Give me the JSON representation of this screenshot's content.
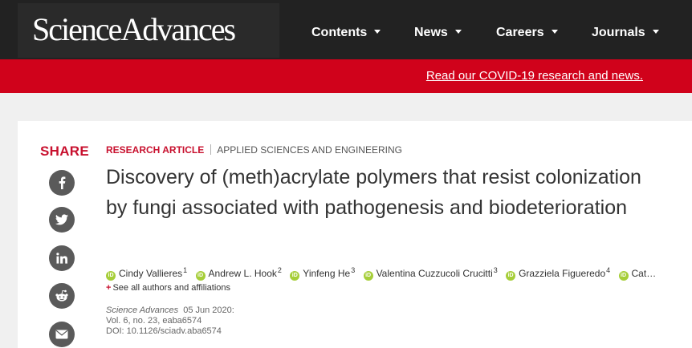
{
  "header": {
    "logo_text": "ScienceAdvances",
    "nav": [
      {
        "label": "Contents"
      },
      {
        "label": "News"
      },
      {
        "label": "Careers"
      },
      {
        "label": "Journals"
      }
    ]
  },
  "banner": {
    "link_text": "Read our COVID-19 research and news."
  },
  "share": {
    "label": "SHARE",
    "icons": [
      "facebook-icon",
      "twitter-icon",
      "linkedin-icon",
      "reddit-icon",
      "email-icon"
    ]
  },
  "article": {
    "type": "RESEARCH ARTICLE",
    "subject": "APPLIED SCIENCES AND ENGINEERING",
    "title": "Discovery of (meth)acrylate polymers that resist colonization by fungi associated with pathogenesis and biodeterioration",
    "authors": [
      {
        "name": "Cindy Vallieres",
        "aff": "1"
      },
      {
        "name": "Andrew L. Hook",
        "aff": "2"
      },
      {
        "name": "Yinfeng He",
        "aff": "3"
      },
      {
        "name": "Valentina Cuzzucoli Crucitti",
        "aff": "3"
      },
      {
        "name": "Grazziela Figueredo",
        "aff": "4"
      },
      {
        "name": "Cat…",
        "aff": ""
      }
    ],
    "orcid_badge": "iD",
    "see_all": "See all authors and affiliations",
    "citation": {
      "journal": "Science Advances",
      "date": "05 Jun 2020:",
      "volume": "Vol. 6, no. 23, eaba6574",
      "doi": "DOI: 10.1126/sciadv.aba6574"
    }
  },
  "colors": {
    "header_bg": "#222222",
    "banner_red": "#d0021b",
    "accent_red": "#c8102e",
    "orcid_green": "#a6ce39",
    "share_icon_bg": "#5a5a5a"
  }
}
